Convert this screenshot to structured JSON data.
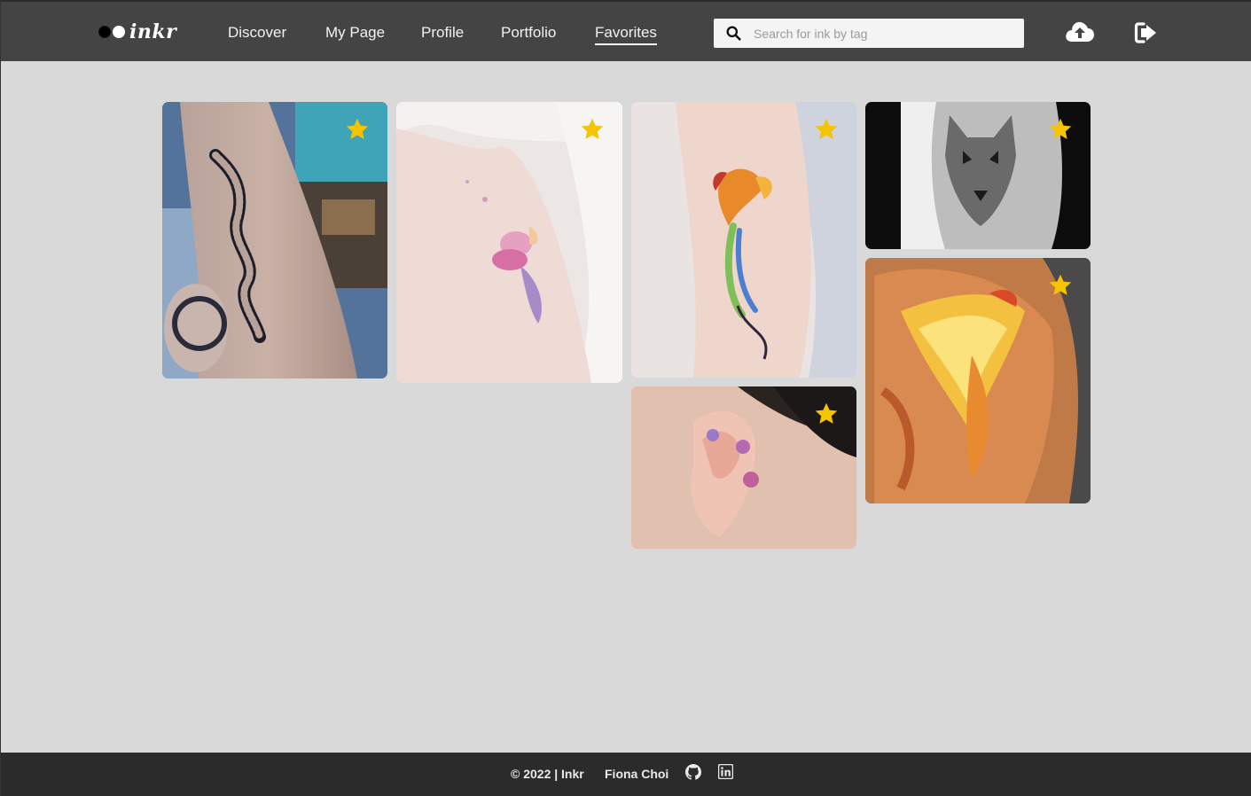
{
  "header": {
    "logo_text": "inkr",
    "nav": [
      {
        "label": "Discover",
        "active": false
      },
      {
        "label": "My Page",
        "active": false
      },
      {
        "label": "Profile",
        "active": false
      },
      {
        "label": "Portfolio",
        "active": false
      },
      {
        "label": "Favorites",
        "active": true
      }
    ],
    "search": {
      "placeholder": "Search for ink by tag",
      "value": ""
    },
    "icons": [
      "upload-cloud-icon",
      "sign-out-icon"
    ]
  },
  "gallery": {
    "items": [
      {
        "subject": "snake-tattoo",
        "favorited": true
      },
      {
        "subject": "fairy-tattoo",
        "favorited": true
      },
      {
        "subject": "phoenix-watercolor-tattoo",
        "favorited": true
      },
      {
        "subject": "ear-flower-tattoo",
        "favorited": true
      },
      {
        "subject": "wolf-tattoo",
        "favorited": true
      },
      {
        "subject": "golden-phoenix-tattoo",
        "favorited": true
      }
    ]
  },
  "footer": {
    "copyright": "© 2022 | Inkr",
    "author": "Fiona Choi",
    "icons": [
      "github-icon",
      "linkedin-icon"
    ]
  },
  "colors": {
    "header_bg": "#444444",
    "page_bg": "#d9d9d9",
    "footer_bg": "#2b2b2b",
    "star": "#f5c400"
  }
}
